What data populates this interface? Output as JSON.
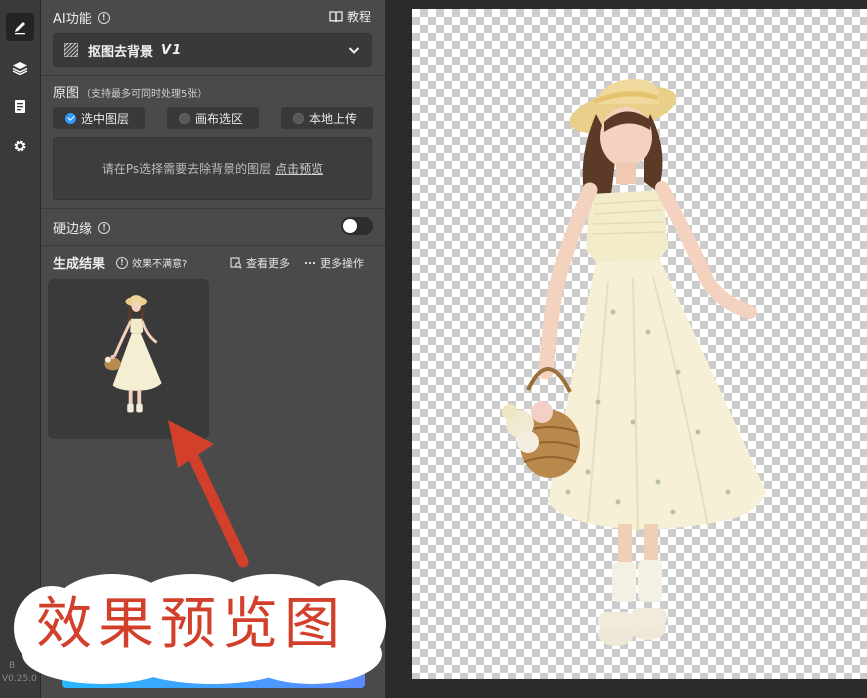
{
  "toolbar": {
    "icons": [
      "pen-icon",
      "layers-icon",
      "clipboard-icon",
      "gear-icon"
    ],
    "version_prefix": "B",
    "version": "V0.25.0"
  },
  "ai": {
    "title": "AI功能",
    "tutorial_label": "教程",
    "dropdown_label": "抠图去背景",
    "dropdown_version": "V1"
  },
  "source": {
    "title": "原图",
    "note": "（支持最多可同时处理5张）",
    "options": [
      {
        "label": "选中图层",
        "selected": true
      },
      {
        "label": "画布选区",
        "selected": false
      },
      {
        "label": "本地上传",
        "selected": false
      }
    ],
    "hint": "请在Ps选择需要去除背景的图层",
    "hint_link": "点击预览"
  },
  "hard_edge": {
    "label": "硬边缘",
    "enabled": false
  },
  "result": {
    "title": "生成结果",
    "unsatisfied": "效果不满意?",
    "view_more": "查看更多",
    "more_ops": "更多操作"
  },
  "annotation": {
    "callout": "效果预览图",
    "color": "#d2402c"
  },
  "colors": {
    "accent": "#2f9bff",
    "panel": "#4a4a4a"
  }
}
